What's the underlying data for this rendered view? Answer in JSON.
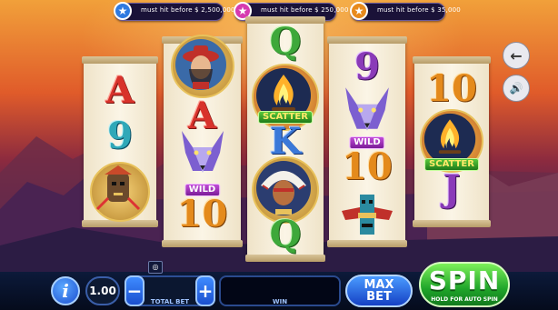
{
  "jackpots": [
    {
      "text": "must hit before $ 2,500,000",
      "color": "#2f7ae0"
    },
    {
      "text": "must hit before $ 250,000",
      "color": "#d63ab0"
    },
    {
      "text": "must hit before $ 35,000",
      "color": "#e88a1c"
    }
  ],
  "reels": {
    "reel1": {
      "s1": "A",
      "s2": "9"
    },
    "reel2": {
      "s1": "A",
      "wild": "WILD",
      "s2": "10"
    },
    "reel3": {
      "s1": "Q",
      "scatter": "SCATTER",
      "s2": "K",
      "s3": "Q"
    },
    "reel4": {
      "s1": "9",
      "wild": "WILD",
      "s2": "10"
    },
    "reel5": {
      "s1": "10",
      "scatter": "SCATTER",
      "s2": "J"
    }
  },
  "controls": {
    "info": "i",
    "bet_value": "1.00",
    "minus": "−",
    "plus": "+",
    "total_bet_label": "TOTAL BET",
    "win_label": "WIN",
    "max_bet_line1": "MAX",
    "max_bet_line2": "BET",
    "spin_label": "SPIN",
    "spin_hint": "HOLD FOR AUTO SPIN"
  },
  "side": {
    "back_icon": "←",
    "sound_icon": "🔊"
  },
  "icons": [
    "star-icon",
    "back-arrow-icon",
    "speaker-icon",
    "info-icon",
    "coins-icon"
  ]
}
